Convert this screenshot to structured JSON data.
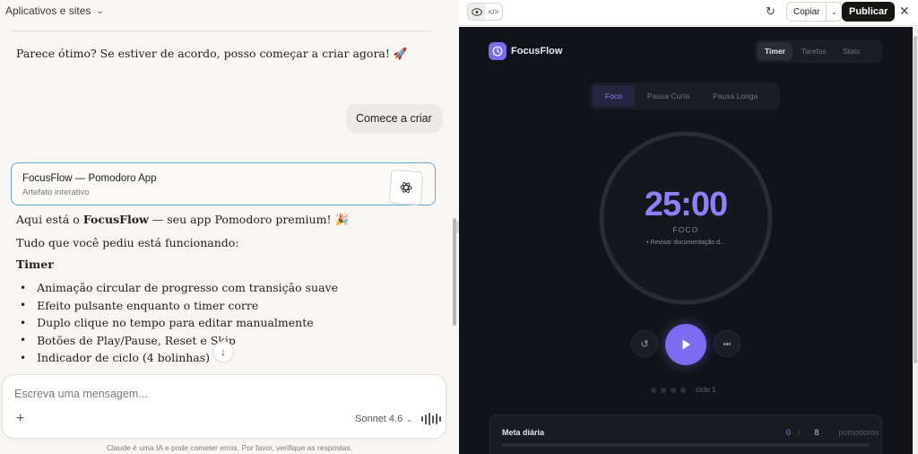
{
  "left": {
    "topbar": {
      "title": "Aplicativos e sites"
    },
    "messages": {
      "m1": "Parece ótimo? Se estiver de acordo, posso começar a criar agora! 🚀",
      "user": "Comece a criar",
      "artifact_title": "FocusFlow — Pomodoro App",
      "artifact_sub": "Artefato interativo",
      "m2_pre": "Aqui está o ",
      "m2_bold": "FocusFlow",
      "m2_post": " — seu app Pomodoro premium! 🎉",
      "m3": "Tudo que você pediu está funcionando:",
      "m4": "Timer",
      "bullets": [
        "Animação circular de progresso com transição suave",
        "Efeito pulsante enquanto o timer corre",
        "Duplo clique no tempo para editar manualmente",
        "Botões de Play/Pause, Reset e Skip",
        "Indicador de ciclo (4 bolinhas)"
      ]
    },
    "composer": {
      "placeholder": "Escreva uma mensagem...",
      "model": "Sonnet 4.6"
    },
    "disclaimer": "Claude é uma IA e pode cometer erros. Por favor, verifique as respostas."
  },
  "right": {
    "toolbar": {
      "copy": "Copiar",
      "publish": "Publicar"
    },
    "app": {
      "name": "FocusFlow",
      "nav": [
        "Timer",
        "Tarefas",
        "Stats"
      ],
      "modes": [
        "Foco",
        "Pausa Curta",
        "Pausa Longa"
      ],
      "time": "25:00",
      "phase": "FOCO",
      "task": "• Revisar documentação d...",
      "cycle": "ciclo 1",
      "goal_title": "Meta diária",
      "goal_done": "0",
      "goal_sep": "/",
      "goal_total": "8",
      "goal_unit": "pomodoros",
      "progress": 0
    },
    "colors": {
      "accent": "#7b6cf2",
      "time": "#8f80ff",
      "app_bg": "#121318"
    }
  }
}
